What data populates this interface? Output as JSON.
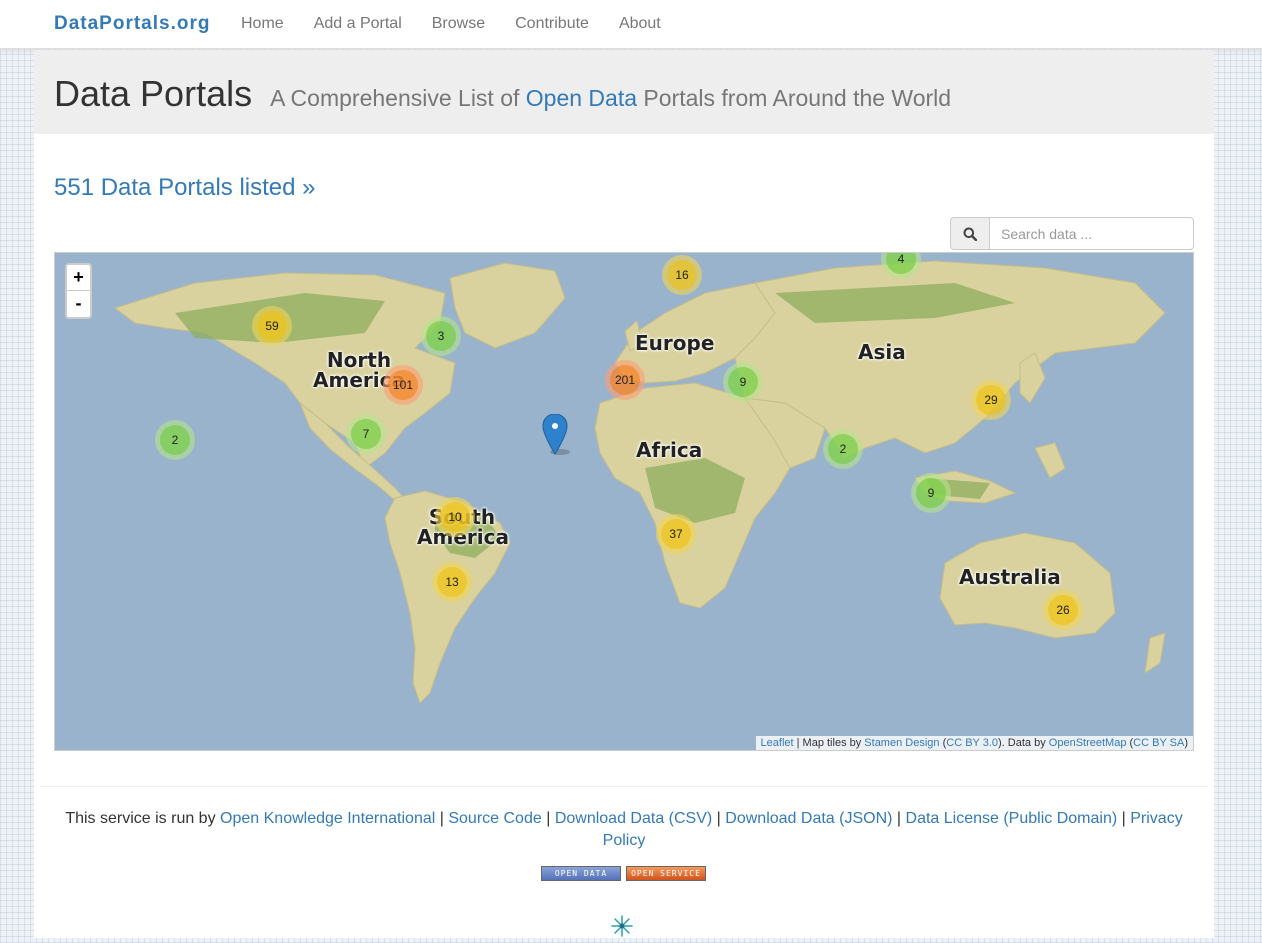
{
  "navbar": {
    "brand": "DataPortals.org",
    "items": [
      "Home",
      "Add a Portal",
      "Browse",
      "Contribute",
      "About"
    ]
  },
  "header": {
    "title": "Data Portals",
    "subtitle_before": "A Comprehensive List of",
    "subtitle_link": "Open Data",
    "subtitle_after": "Portals from Around the World"
  },
  "count_link": "551 Data Portals listed »",
  "search": {
    "placeholder": "Search data ...",
    "icon": "search-icon"
  },
  "map": {
    "zoom_in": "+",
    "zoom_out": "-",
    "continents": [
      "North America",
      "Europe",
      "Asia",
      "Africa",
      "South America",
      "Australia"
    ],
    "clusters": [
      "59",
      "3",
      "101",
      "7",
      "2",
      "16",
      "4",
      "201",
      "9",
      "29",
      "2",
      "9",
      "10",
      "13",
      "37",
      "26"
    ],
    "attribution": {
      "leaflet": "Leaflet",
      "sep1": " | Map tiles by ",
      "stamen": "Stamen Design",
      "cc_by": "CC BY 3.0",
      "data_by": "). Data by ",
      "osm": "OpenStreetMap",
      "cc_by_sa": "CC BY SA"
    },
    "colors": {
      "water": "#99b3cc",
      "land": "#d9d29f",
      "forest": "#8fae5e"
    }
  },
  "footer": {
    "run_by": "This service is run by",
    "okfn": "Open Knowledge International",
    "source": "Source Code",
    "csv": "Download Data (CSV)",
    "json": "Download Data (JSON)",
    "license": "Data License (Public Domain)",
    "privacy": "Privacy Policy",
    "sep": "|"
  },
  "badges": {
    "open_data": "OPEN DATA",
    "open_service": "OPEN SERVICE"
  }
}
